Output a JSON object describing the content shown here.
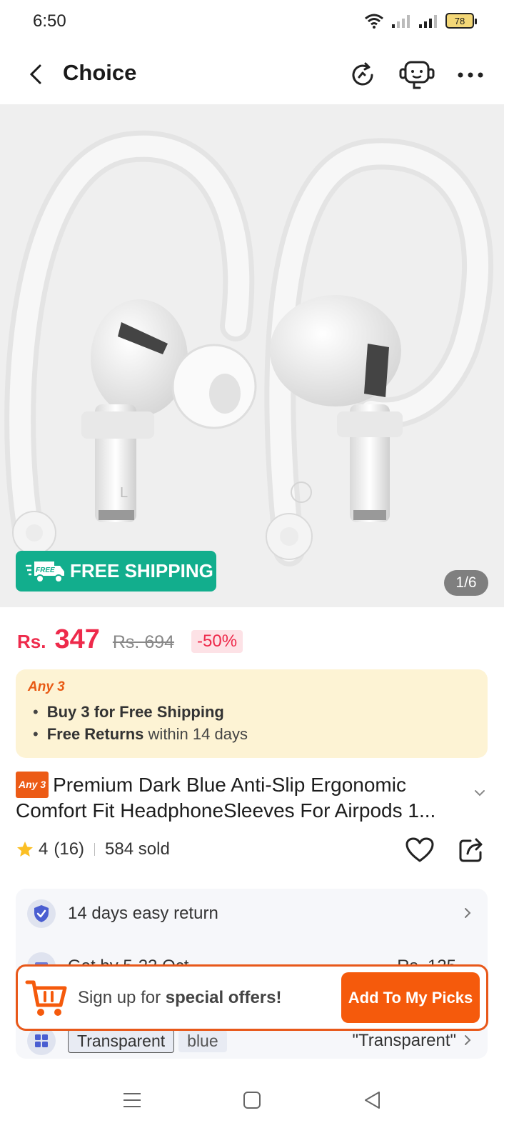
{
  "status_bar": {
    "time": "6:50",
    "battery": "78"
  },
  "nav": {
    "title": "Choice"
  },
  "hero": {
    "free_shipping_label": "FREE SHIPPING",
    "free_badge": "FREE",
    "counter": "1/6"
  },
  "price": {
    "currency": "Rs.",
    "current": "347",
    "original": "Rs. 694",
    "discount": "-50%"
  },
  "promo": {
    "tag": "Any 3",
    "line1": "Buy 3 for  Free Shipping",
    "line2_bold": "Free Returns",
    "line2_rest": "within 14 days"
  },
  "product": {
    "badge": "Any 3",
    "title": "Premium Dark Blue Anti-Slip Ergonomic Comfort Fit HeadphoneSleeves For Airpods 1..."
  },
  "rating": {
    "score": "4",
    "count": "(16)",
    "sold": "584 sold"
  },
  "services": {
    "return": "14 days easy return",
    "delivery": "Get by 5-22 Oct",
    "delivery_price": "Rs. 125",
    "variant_selected": "Transparent",
    "variant_other": "blue",
    "variant_value": "\"Transparent\""
  },
  "signup": {
    "text_prefix": "Sign up for",
    "text_bold": "special offers!",
    "button": "Add To My Picks"
  },
  "colors": {
    "accent": "#f55a0c",
    "price_red": "#ee2a4b",
    "free_shipping_green": "#12ae8d",
    "promo_bg": "#fdf3d4"
  }
}
